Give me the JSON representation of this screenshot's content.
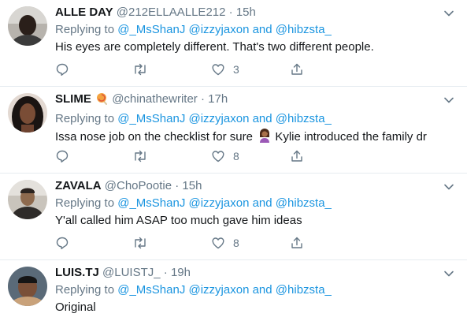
{
  "tweets": [
    {
      "name": "ALLE DAY",
      "handle": "@212ELLAALLE212",
      "dot": "·",
      "time": "15h",
      "replying_prefix": "Replying to",
      "mention1": "@_MsShanJ",
      "mention2": "@izzyjaxon",
      "and": "and",
      "mention3": "@hibzsta_",
      "text": "His eyes are completely different. That's two different people.",
      "likes": "3",
      "name_emoji": ""
    },
    {
      "name": "SLIME",
      "handle": "@chinathewriter",
      "dot": "·",
      "time": "17h",
      "replying_prefix": "Replying to",
      "mention1": "@_MsShanJ",
      "mention2": "@izzyjaxon",
      "and": "and",
      "mention3": "@hibzsta_",
      "text_before": "Issa nose job on the checklist for sure",
      "text_after": "Kylie introduced the family dr",
      "likes": "8",
      "name_emoji": "lollipop-icon"
    },
    {
      "name": "ZAVALA",
      "handle": "@ChoPootie",
      "dot": "·",
      "time": "15h",
      "replying_prefix": "Replying to",
      "mention1": "@_MsShanJ",
      "mention2": "@izzyjaxon",
      "and": "and",
      "mention3": "@hibzsta_",
      "text": "Y'all called him ASAP too much gave him ideas",
      "likes": "8",
      "name_emoji": ""
    },
    {
      "name": "LUIS.TJ",
      "handle": "@LUISTJ_",
      "dot": "·",
      "time": "19h",
      "replying_prefix": "Replying to",
      "mention1": "@_MsShanJ",
      "mention2": "@izzyjaxon",
      "and": "and",
      "mention3": "@hibzsta_",
      "text": "Original",
      "name_emoji": ""
    }
  ],
  "colors": {
    "link": "#1b95e0",
    "muted": "#657786",
    "text": "#14171a",
    "divider": "#e6ecf0"
  }
}
